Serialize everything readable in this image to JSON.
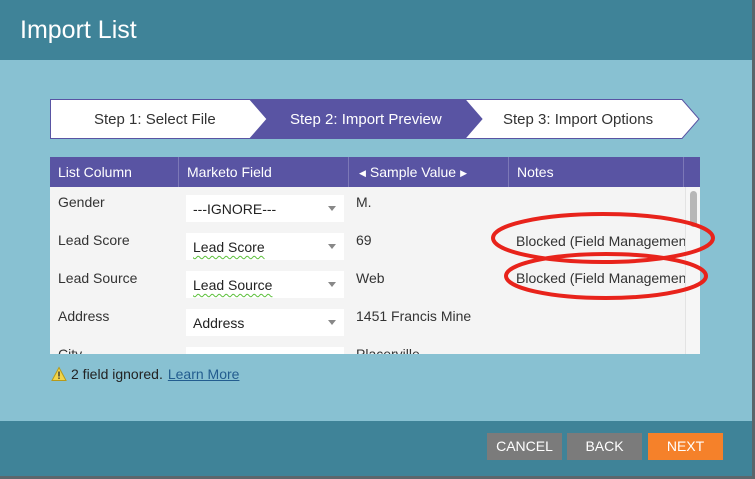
{
  "dialog": {
    "title": "Import List"
  },
  "steps": [
    {
      "label": "Step 1: Select File",
      "active": false
    },
    {
      "label": "Step 2: Import Preview",
      "active": true
    },
    {
      "label": "Step 3: Import Options",
      "active": false
    }
  ],
  "table": {
    "columns": {
      "list_column": "List Column",
      "marketo_field": "Marketo Field",
      "sample_value": "Sample Value",
      "notes": "Notes"
    },
    "rows": [
      {
        "list_column": "Gender",
        "marketo_field": "---IGNORE---",
        "sample_value": "M.",
        "notes": ""
      },
      {
        "list_column": "Lead Score",
        "marketo_field": "Lead Score",
        "sample_value": "69",
        "notes": "Blocked (Field Management"
      },
      {
        "list_column": "Lead Source",
        "marketo_field": "Lead Source",
        "sample_value": "Web",
        "notes": "Blocked (Field Management"
      },
      {
        "list_column": "Address",
        "marketo_field": "Address",
        "sample_value": "1451 Francis Mine",
        "notes": ""
      },
      {
        "list_column": "City",
        "marketo_field": "",
        "sample_value": "Placerville",
        "notes": ""
      }
    ]
  },
  "warning": {
    "text": "2 field ignored.",
    "link": "Learn More"
  },
  "footer": {
    "cancel": "CANCEL",
    "back": "BACK",
    "next": "NEXT"
  },
  "colors": {
    "header": "#3f8398",
    "body": "#88c1d2",
    "table_header": "#5954a3",
    "active_step": "#5954a3",
    "next_button": "#f5812a",
    "secondary_button": "#7b7b7b",
    "annotation": "#e8231b"
  },
  "icons": {
    "warning": "warning-triangle-icon",
    "dropdown": "chevron-down-icon",
    "sort_left": "arrow-left-icon",
    "sort_right": "arrow-right-icon"
  }
}
